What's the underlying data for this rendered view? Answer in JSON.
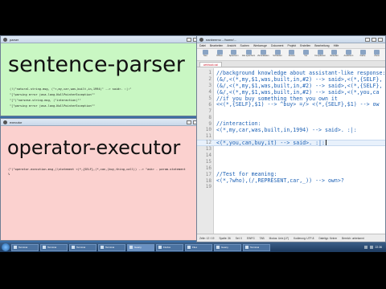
{
  "parser_window": {
    "title": "parser",
    "heading": "sentence-parser",
    "lines": [
      "(!(\"natural-string-msg, (\"<,my,car,was,built,in,1994)\" --> said>. :|:\"",
      "\"[\"parsing error java.lang.NullPointerException\"\"",
      "\"[\"(\"narsese-string-msg, (\"interaction)\"\"",
      "\"[\"parsing error java.lang.NullPointerException\"\"",
      ""
    ]
  },
  "executor_window": {
    "title": "executor",
    "heading": "operator-executor",
    "lines": [
      "(\"(\"operator-execution-msg,(\\statement <(*,{SELF},(*,can,(buy,thing,call)) --> ^ask> - param-statement",
      "%"
    ]
  },
  "editor_window": {
    "title": "nanbeemo - /home/...",
    "menu": [
      "Datei",
      "Bearbeiten",
      "Ansicht",
      "Suchen",
      "Werkzeuge",
      "Dokument",
      "Projekt",
      "Erstellen",
      "Bearbeitung",
      "Hilfe"
    ],
    "toolbar": [
      "Neu",
      "Öffnen",
      "Speichern",
      "Alle speichern",
      "Zurückladen",
      "Schließen",
      "Zurück",
      "Vor",
      "Kompilieren",
      "Erstellen",
      "Ausführen",
      "Farbe",
      "Zoom"
    ],
    "tab_label": "webhook.nal",
    "code_lines": [
      {
        "n": "1",
        "text": "//background knowledge about assistant-like response:"
      },
      {
        "n": "2",
        "text": "(&/,<(*,my,$1,was,built,in,#2) --> said>,<(*,{SELF},"
      },
      {
        "n": "3",
        "text": "(&/,<(*,my,$1,was,built,in,#2) --> said>,<(*,{SELF},"
      },
      {
        "n": "4",
        "text": "(&/,<(*,my,$1,was,built,in,#2) --> said>,<(*,you,ca"
      },
      {
        "n": "5",
        "text": "//if you buy something then you own it"
      },
      {
        "n": "6",
        "text": "<<(*,{SELF},$1) --> ^buy> =/> <(*,{SELF},$1) --> ow"
      },
      {
        "n": "7",
        "text": ""
      },
      {
        "n": "8",
        "text": ""
      },
      {
        "n": "9",
        "text": "//interaction:"
      },
      {
        "n": "10",
        "text": "<(*,my,car,was,built,in,1994) --> said>. :|:"
      },
      {
        "n": "11",
        "text": ""
      },
      {
        "n": "12",
        "text": "<(*,you,can,buy,it) --> said>. :|:"
      },
      {
        "n": "13",
        "text": ""
      },
      {
        "n": "14",
        "text": ""
      },
      {
        "n": "15",
        "text": ""
      },
      {
        "n": "16",
        "text": ""
      },
      {
        "n": "17",
        "text": "//Test for meaning:"
      },
      {
        "n": "18",
        "text": "<(*,?who),(/,REPRESENT,car,_)) --> own>?"
      },
      {
        "n": "19",
        "text": ""
      }
    ],
    "status": [
      "Zeile: 12 / 19",
      "Spalte: 36",
      "Sel: 0",
      "EINFG",
      "TAB",
      "Modus: Unix (LF)",
      "Kodierung: UTF-8",
      "Dateityp: Keiner",
      "Bereich: unbekannt"
    ]
  },
  "taskbar": {
    "items": [
      "Terminal",
      "Terminal",
      "Terminal",
      "Terminal",
      "Geany",
      "Firefox",
      "Files",
      "Geany",
      "Terminal"
    ],
    "clock": "22:36",
    "active_index": 4
  }
}
